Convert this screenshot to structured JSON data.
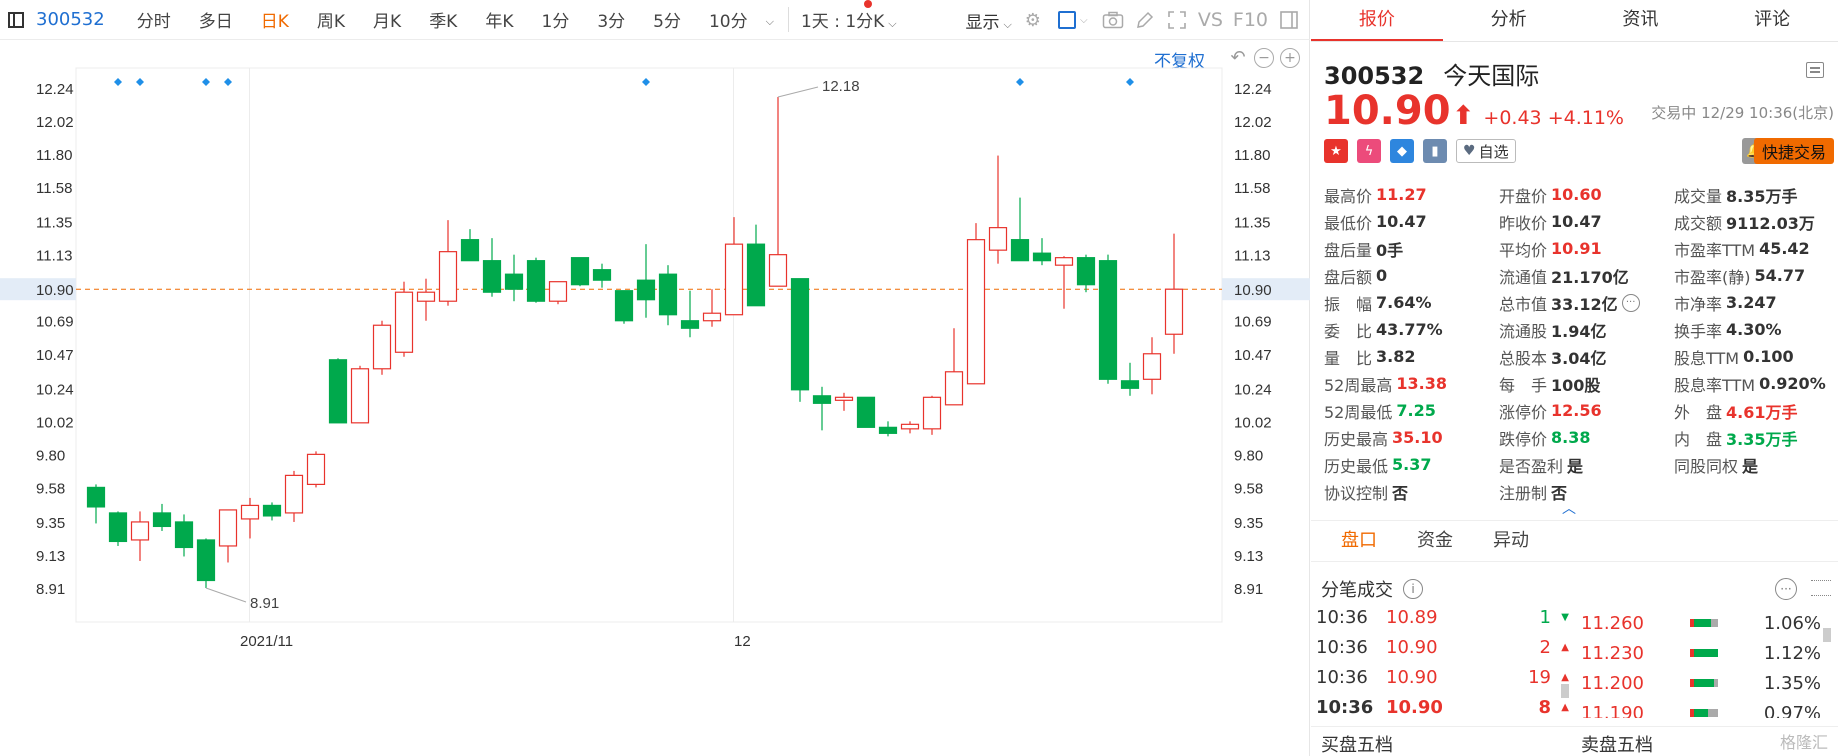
{
  "toolbar": {
    "code": "300532",
    "periods": [
      "分时",
      "多日",
      "日K",
      "周K",
      "月K",
      "季K",
      "年K",
      "1分",
      "3分",
      "5分",
      "10分"
    ],
    "active_period": "日K",
    "multi_day_select": "1天 : 1分K",
    "display_label": "显示",
    "vs_label": "VS",
    "f10_label": "F10"
  },
  "chart_controls": {
    "fuquan_label": "不复权"
  },
  "chart_data": {
    "type": "candlestick",
    "y_ticks": [
      "12.24",
      "12.02",
      "11.80",
      "11.58",
      "11.35",
      "11.13",
      "10.90",
      "10.69",
      "10.47",
      "10.24",
      "10.02",
      "9.80",
      "9.58",
      "9.35",
      "9.13",
      "8.91"
    ],
    "ylim": [
      8.91,
      12.24
    ],
    "x_labels": [
      {
        "label": "2021/11",
        "index": 7
      },
      {
        "label": "12",
        "index": 29
      }
    ],
    "current_price_line": 10.9,
    "current_price_label": "10.90",
    "high_annotation": {
      "label": "12.18",
      "index": 31,
      "value": 12.18
    },
    "low_annotation": {
      "label": "8.91",
      "index": 5,
      "value": 8.91
    },
    "event_marker_indices": [
      1,
      2,
      5,
      6,
      25,
      42,
      47
    ],
    "candles": [
      {
        "o": 9.58,
        "h": 9.6,
        "l": 9.34,
        "c": 9.45
      },
      {
        "o": 9.41,
        "h": 9.42,
        "l": 9.19,
        "c": 9.22
      },
      {
        "o": 9.23,
        "h": 9.42,
        "l": 9.09,
        "c": 9.35
      },
      {
        "o": 9.41,
        "h": 9.47,
        "l": 9.29,
        "c": 9.32
      },
      {
        "o": 9.35,
        "h": 9.4,
        "l": 9.12,
        "c": 9.18
      },
      {
        "o": 9.23,
        "h": 9.24,
        "l": 8.91,
        "c": 8.96
      },
      {
        "o": 9.19,
        "h": 9.43,
        "l": 9.08,
        "c": 9.43
      },
      {
        "o": 9.37,
        "h": 9.51,
        "l": 9.24,
        "c": 9.46
      },
      {
        "o": 9.46,
        "h": 9.48,
        "l": 9.36,
        "c": 9.39
      },
      {
        "o": 9.41,
        "h": 9.69,
        "l": 9.35,
        "c": 9.66
      },
      {
        "o": 9.6,
        "h": 9.82,
        "l": 9.58,
        "c": 9.8
      },
      {
        "o": 10.43,
        "h": 10.44,
        "l": 10.01,
        "c": 10.01
      },
      {
        "o": 10.01,
        "h": 10.39,
        "l": 10.01,
        "c": 10.37
      },
      {
        "o": 10.37,
        "h": 10.69,
        "l": 10.33,
        "c": 10.66
      },
      {
        "o": 10.48,
        "h": 10.95,
        "l": 10.45,
        "c": 10.88
      },
      {
        "o": 10.82,
        "h": 10.97,
        "l": 10.69,
        "c": 10.88
      },
      {
        "o": 10.82,
        "h": 11.36,
        "l": 10.79,
        "c": 11.15
      },
      {
        "o": 11.23,
        "h": 11.3,
        "l": 11.09,
        "c": 11.09
      },
      {
        "o": 11.09,
        "h": 11.24,
        "l": 10.85,
        "c": 10.88
      },
      {
        "o": 11.0,
        "h": 11.13,
        "l": 10.82,
        "c": 10.9
      },
      {
        "o": 11.09,
        "h": 11.11,
        "l": 10.81,
        "c": 10.82
      },
      {
        "o": 10.82,
        "h": 10.95,
        "l": 10.8,
        "c": 10.95
      },
      {
        "o": 11.11,
        "h": 11.11,
        "l": 10.92,
        "c": 10.93
      },
      {
        "o": 11.03,
        "h": 11.07,
        "l": 10.91,
        "c": 10.96
      },
      {
        "o": 10.89,
        "h": 10.89,
        "l": 10.67,
        "c": 10.69
      },
      {
        "o": 10.96,
        "h": 11.2,
        "l": 10.71,
        "c": 10.83
      },
      {
        "o": 11.0,
        "h": 11.06,
        "l": 10.66,
        "c": 10.73
      },
      {
        "o": 10.69,
        "h": 10.89,
        "l": 10.58,
        "c": 10.64
      },
      {
        "o": 10.69,
        "h": 10.9,
        "l": 10.65,
        "c": 10.74
      },
      {
        "o": 10.73,
        "h": 11.38,
        "l": 10.73,
        "c": 11.2
      },
      {
        "o": 11.2,
        "h": 11.33,
        "l": 10.79,
        "c": 10.79
      },
      {
        "o": 10.92,
        "h": 12.18,
        "l": 10.92,
        "c": 11.13
      },
      {
        "o": 10.97,
        "h": 10.97,
        "l": 10.15,
        "c": 10.23
      },
      {
        "o": 10.19,
        "h": 10.25,
        "l": 9.96,
        "c": 10.14
      },
      {
        "o": 10.16,
        "h": 10.21,
        "l": 10.09,
        "c": 10.18
      },
      {
        "o": 10.18,
        "h": 10.18,
        "l": 9.98,
        "c": 9.98
      },
      {
        "o": 9.98,
        "h": 10.02,
        "l": 9.92,
        "c": 9.94
      },
      {
        "o": 9.97,
        "h": 10.02,
        "l": 9.94,
        "c": 10.0
      },
      {
        "o": 9.97,
        "h": 10.19,
        "l": 9.93,
        "c": 10.18
      },
      {
        "o": 10.13,
        "h": 10.64,
        "l": 10.13,
        "c": 10.35
      },
      {
        "o": 10.27,
        "h": 11.34,
        "l": 10.27,
        "c": 11.23
      },
      {
        "o": 11.16,
        "h": 11.79,
        "l": 11.07,
        "c": 11.31
      },
      {
        "o": 11.23,
        "h": 11.51,
        "l": 11.1,
        "c": 11.09
      },
      {
        "o": 11.14,
        "h": 11.24,
        "l": 11.06,
        "c": 11.09
      },
      {
        "o": 11.06,
        "h": 11.12,
        "l": 10.77,
        "c": 11.11
      },
      {
        "o": 11.11,
        "h": 11.13,
        "l": 10.88,
        "c": 10.93
      },
      {
        "o": 11.09,
        "h": 11.13,
        "l": 10.27,
        "c": 10.3
      },
      {
        "o": 10.29,
        "h": 10.41,
        "l": 10.19,
        "c": 10.24
      },
      {
        "o": 10.3,
        "h": 10.58,
        "l": 10.2,
        "c": 10.47
      },
      {
        "o": 10.6,
        "h": 11.27,
        "l": 10.47,
        "c": 10.9
      }
    ],
    "up_color": "#e8332c",
    "down_color": "#00a94c",
    "price_line_color": "#f06a00",
    "grid": true
  },
  "quote": {
    "tabs": [
      "报价",
      "分析",
      "资讯",
      "评论"
    ],
    "active_tab": "报价",
    "code": "300532",
    "name": "今天国际",
    "price": "10.90",
    "change": "+0.43",
    "change_pct": "+4.11%",
    "status": "交易中 12/29 10:36(北京)",
    "zixuan_label": "自选",
    "fast_trade_label": "快捷交易",
    "stats": [
      {
        "label": "最高价",
        "value": "11.27",
        "color": "red"
      },
      {
        "label": "开盘价",
        "value": "10.60",
        "color": "red"
      },
      {
        "label": "成交量",
        "value": "8.35万手",
        "color": ""
      },
      {
        "label": "最低价",
        "value": "10.47",
        "color": ""
      },
      {
        "label": "昨收价",
        "value": "10.47",
        "color": ""
      },
      {
        "label": "成交额",
        "value": "9112.03万",
        "color": ""
      },
      {
        "label": "盘后量",
        "value": "0手",
        "color": ""
      },
      {
        "label": "平均价",
        "value": "10.91",
        "color": "red"
      },
      {
        "label": "市盈率TTM",
        "value": "45.42",
        "color": ""
      },
      {
        "label": "盘后额",
        "value": "0",
        "color": ""
      },
      {
        "label": "流通值",
        "value": "21.170亿",
        "color": ""
      },
      {
        "label": "市盈率(静)",
        "value": "54.77",
        "color": ""
      },
      {
        "label": "振　幅",
        "value": "7.64%",
        "color": ""
      },
      {
        "label": "总市值",
        "value": "33.12亿",
        "color": ""
      },
      {
        "label": "市净率",
        "value": "3.247",
        "color": ""
      },
      {
        "label": "委　比",
        "value": "43.77%",
        "color": ""
      },
      {
        "label": "流通股",
        "value": "1.94亿",
        "color": ""
      },
      {
        "label": "换手率",
        "value": "4.30%",
        "color": ""
      },
      {
        "label": "量　比",
        "value": "3.82",
        "color": ""
      },
      {
        "label": "总股本",
        "value": "3.04亿",
        "color": ""
      },
      {
        "label": "股息TTM",
        "value": "0.100",
        "color": ""
      },
      {
        "label": "52周最高",
        "value": "13.38",
        "color": "red"
      },
      {
        "label": "每　手",
        "value": "100股",
        "color": ""
      },
      {
        "label": "股息率TTM",
        "value": "0.920%",
        "color": ""
      },
      {
        "label": "52周最低",
        "value": "7.25",
        "color": "green"
      },
      {
        "label": "涨停价",
        "value": "12.56",
        "color": "red"
      },
      {
        "label": "外　盘",
        "value": "4.61万手",
        "color": "red"
      },
      {
        "label": "历史最高",
        "value": "35.10",
        "color": "red"
      },
      {
        "label": "跌停价",
        "value": "8.38",
        "color": "green"
      },
      {
        "label": "内　盘",
        "value": "3.35万手",
        "color": "green"
      },
      {
        "label": "历史最低",
        "value": "5.37",
        "color": "green"
      },
      {
        "label": "是否盈利",
        "value": "是",
        "color": ""
      },
      {
        "label": "同股同权",
        "value": "是",
        "color": ""
      },
      {
        "label": "协议控制",
        "value": "否",
        "color": ""
      },
      {
        "label": "注册制",
        "value": "否",
        "color": ""
      },
      {
        "label": "",
        "value": "",
        "color": ""
      }
    ]
  },
  "panel": {
    "sub_tabs": [
      "盘口",
      "资金",
      "异动"
    ],
    "active_sub_tab": "盘口",
    "tick_title": "分笔成交",
    "ticks": [
      {
        "time": "10:36",
        "price": "10.89",
        "vol": "1",
        "dir": "down"
      },
      {
        "time": "10:36",
        "price": "10.90",
        "vol": "2",
        "dir": "up"
      },
      {
        "time": "10:36",
        "price": "10.90",
        "vol": "19",
        "dir": "up"
      },
      {
        "time": "10:36",
        "price": "10.90",
        "vol": "8",
        "dir": "up"
      }
    ],
    "levels": [
      {
        "price": "11.260",
        "pct": "1.06%",
        "fill": 0.7
      },
      {
        "price": "11.230",
        "pct": "1.12%",
        "fill": 1.0
      },
      {
        "price": "11.200",
        "pct": "1.35%",
        "fill": 0.85
      },
      {
        "price": "11.190",
        "pct": "0.97%",
        "fill": 0.6
      }
    ],
    "buy_label": "买盘五档",
    "sell_label": "卖盘五档",
    "watermark": "格隆汇"
  }
}
